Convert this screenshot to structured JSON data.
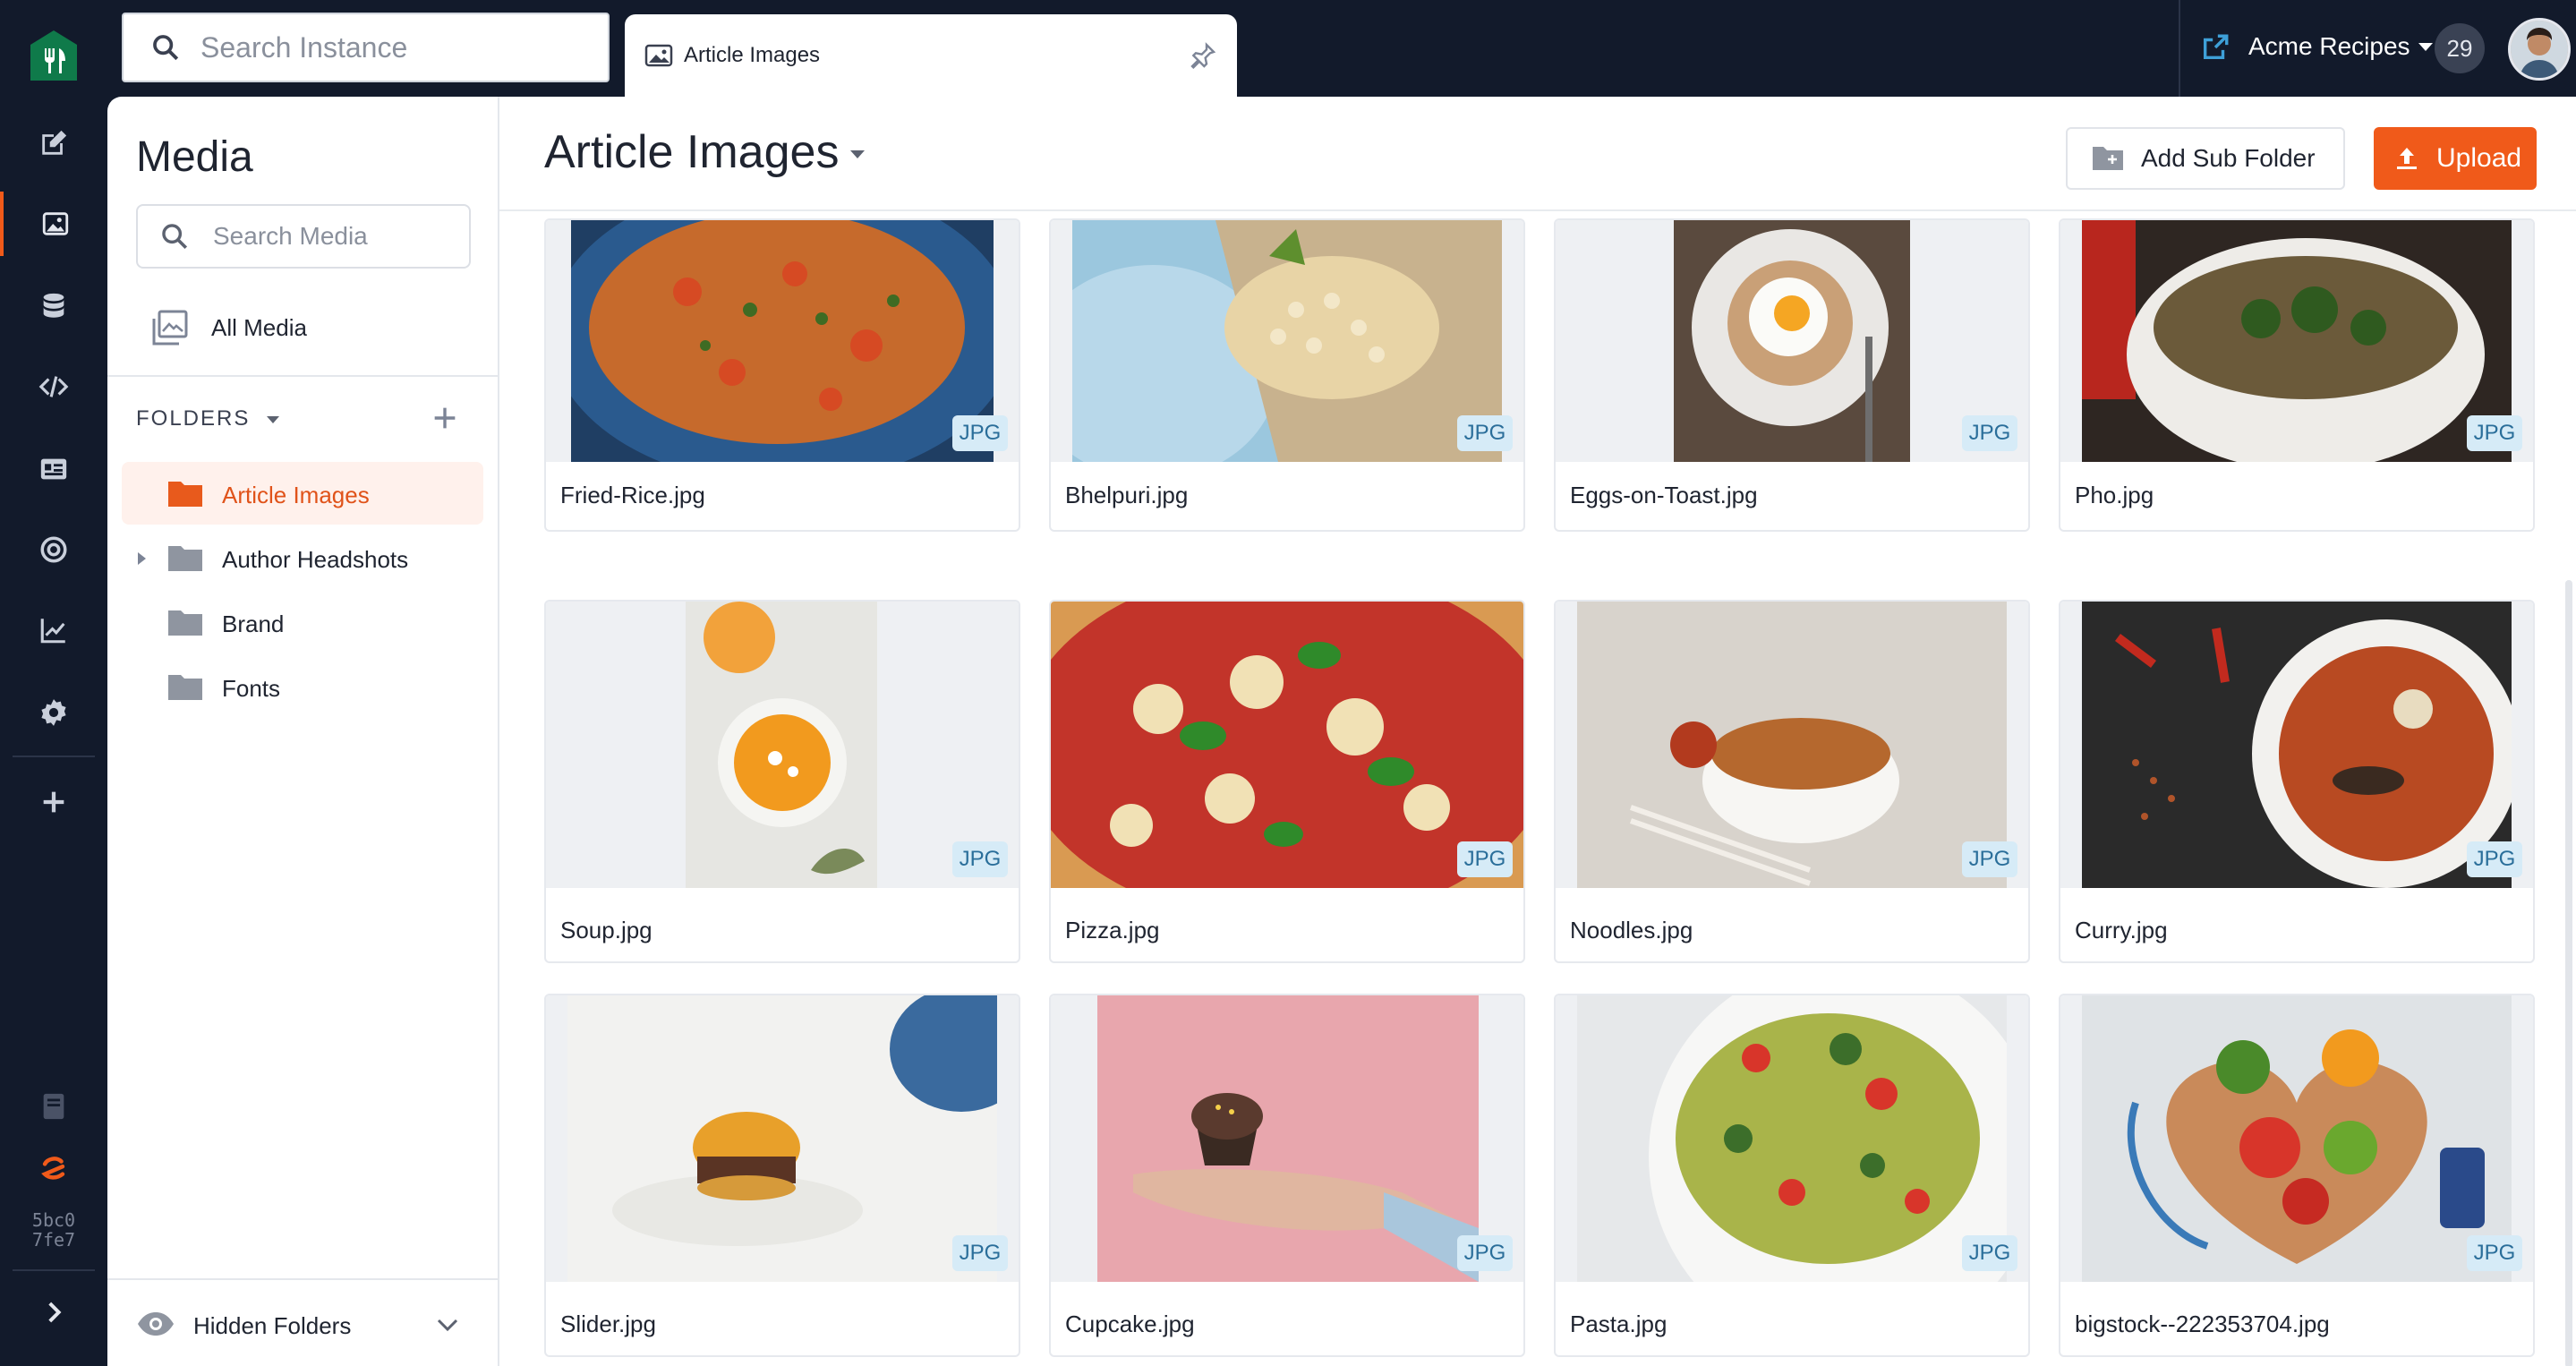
{
  "topbar": {
    "search_placeholder": "Search Instance",
    "tab_label": "Article Images",
    "instance_name": "Acme Recipes",
    "notification_count": "29"
  },
  "rail": {
    "version": "5bc0\n7fe7",
    "brand_color": "#0f7a4a",
    "accent_color": "#f05a1a"
  },
  "media": {
    "title": "Media",
    "search_placeholder": "Search Media",
    "all_media": "All Media",
    "folders_heading": "FOLDERS",
    "folders": [
      {
        "name": "Article Images",
        "active": true
      },
      {
        "name": "Author Headshots",
        "expandable": true
      },
      {
        "name": "Brand"
      },
      {
        "name": "Fonts"
      }
    ],
    "hidden_folders": "Hidden Folders"
  },
  "main": {
    "title": "Article Images",
    "add_sub_folder": "Add Sub Folder",
    "upload": "Upload",
    "files": [
      {
        "name": "Fried-Rice.jpg",
        "type": "JPG"
      },
      {
        "name": "Bhelpuri.jpg",
        "type": "JPG"
      },
      {
        "name": "Eggs-on-Toast.jpg",
        "type": "JPG"
      },
      {
        "name": "Pho.jpg",
        "type": "JPG"
      },
      {
        "name": "Soup.jpg",
        "type": "JPG"
      },
      {
        "name": "Pizza.jpg",
        "type": "JPG"
      },
      {
        "name": "Noodles.jpg",
        "type": "JPG"
      },
      {
        "name": "Curry.jpg",
        "type": "JPG"
      },
      {
        "name": "Slider.jpg",
        "type": "JPG"
      },
      {
        "name": "Cupcake.jpg",
        "type": "JPG"
      },
      {
        "name": "Pasta.jpg",
        "type": "JPG"
      },
      {
        "name": "bigstock--222353704.jpg",
        "type": "JPG"
      }
    ]
  }
}
